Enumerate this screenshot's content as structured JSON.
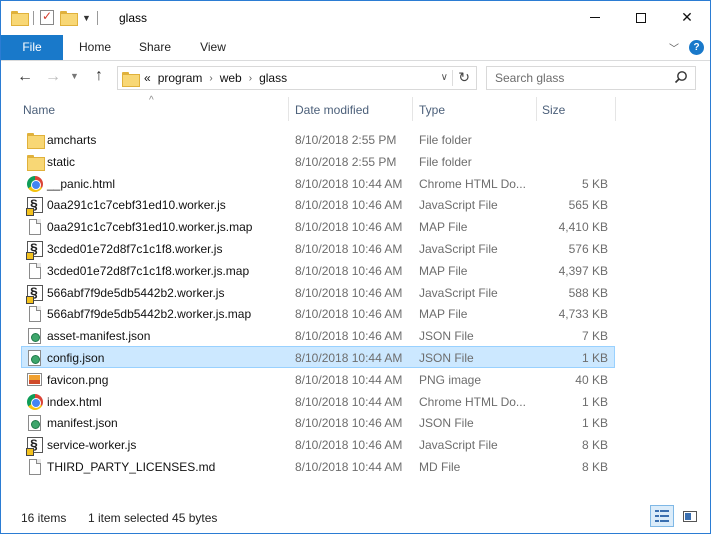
{
  "window": {
    "title": "glass",
    "controls": {
      "minimize": "minimize",
      "maximize": "maximize",
      "close": "✕"
    }
  },
  "ribbon": {
    "tabs": [
      {
        "label": "File"
      },
      {
        "label": "Home"
      },
      {
        "label": "Share"
      },
      {
        "label": "View"
      }
    ]
  },
  "nav": {
    "breadcrumb": [
      "«",
      "program",
      "web",
      "glass"
    ],
    "search_placeholder": "Search glass"
  },
  "columns": {
    "name": "Name",
    "date": "Date modified",
    "type": "Type",
    "size": "Size"
  },
  "files": [
    {
      "name": "amcharts",
      "date": "8/10/2018 2:55 PM",
      "type": "File folder",
      "size": "",
      "icon": "folder-icon"
    },
    {
      "name": "static",
      "date": "8/10/2018 2:55 PM",
      "type": "File folder",
      "size": "",
      "icon": "folder-icon"
    },
    {
      "name": "__panic.html",
      "date": "8/10/2018 10:44 AM",
      "type": "Chrome HTML Do...",
      "size": "5 KB",
      "icon": "chrome-icon"
    },
    {
      "name": "0aa291c1c7cebf31ed10.worker.js",
      "date": "8/10/2018 10:46 AM",
      "type": "JavaScript File",
      "size": "565 KB",
      "icon": "javascript-file-icon"
    },
    {
      "name": "0aa291c1c7cebf31ed10.worker.js.map",
      "date": "8/10/2018 10:46 AM",
      "type": "MAP File",
      "size": "4,410 KB",
      "icon": "generic-file-icon"
    },
    {
      "name": "3cded01e72d8f7c1c1f8.worker.js",
      "date": "8/10/2018 10:46 AM",
      "type": "JavaScript File",
      "size": "576 KB",
      "icon": "javascript-file-icon"
    },
    {
      "name": "3cded01e72d8f7c1c1f8.worker.js.map",
      "date": "8/10/2018 10:46 AM",
      "type": "MAP File",
      "size": "4,397 KB",
      "icon": "generic-file-icon"
    },
    {
      "name": "566abf7f9de5db5442b2.worker.js",
      "date": "8/10/2018 10:46 AM",
      "type": "JavaScript File",
      "size": "588 KB",
      "icon": "javascript-file-icon"
    },
    {
      "name": "566abf7f9de5db5442b2.worker.js.map",
      "date": "8/10/2018 10:46 AM",
      "type": "MAP File",
      "size": "4,733 KB",
      "icon": "generic-file-icon"
    },
    {
      "name": "asset-manifest.json",
      "date": "8/10/2018 10:46 AM",
      "type": "JSON File",
      "size": "7 KB",
      "icon": "json-file-icon"
    },
    {
      "name": "config.json",
      "date": "8/10/2018 10:44 AM",
      "type": "JSON File",
      "size": "1 KB",
      "icon": "json-file-icon",
      "selected": true
    },
    {
      "name": "favicon.png",
      "date": "8/10/2018 10:44 AM",
      "type": "PNG image",
      "size": "40 KB",
      "icon": "png-image-icon"
    },
    {
      "name": "index.html",
      "date": "8/10/2018 10:44 AM",
      "type": "Chrome HTML Do...",
      "size": "1 KB",
      "icon": "chrome-icon"
    },
    {
      "name": "manifest.json",
      "date": "8/10/2018 10:46 AM",
      "type": "JSON File",
      "size": "1 KB",
      "icon": "json-file-icon"
    },
    {
      "name": "service-worker.js",
      "date": "8/10/2018 10:46 AM",
      "type": "JavaScript File",
      "size": "8 KB",
      "icon": "javascript-file-icon"
    },
    {
      "name": "THIRD_PARTY_LICENSES.md",
      "date": "8/10/2018 10:44 AM",
      "type": "MD File",
      "size": "8 KB",
      "icon": "generic-file-icon"
    }
  ],
  "status": {
    "count": "16 items",
    "selection": "1 item selected  45 bytes"
  },
  "colors": {
    "accent": "#1979ca",
    "selection_bg": "#cce8ff",
    "selection_border": "#99d1ff"
  }
}
